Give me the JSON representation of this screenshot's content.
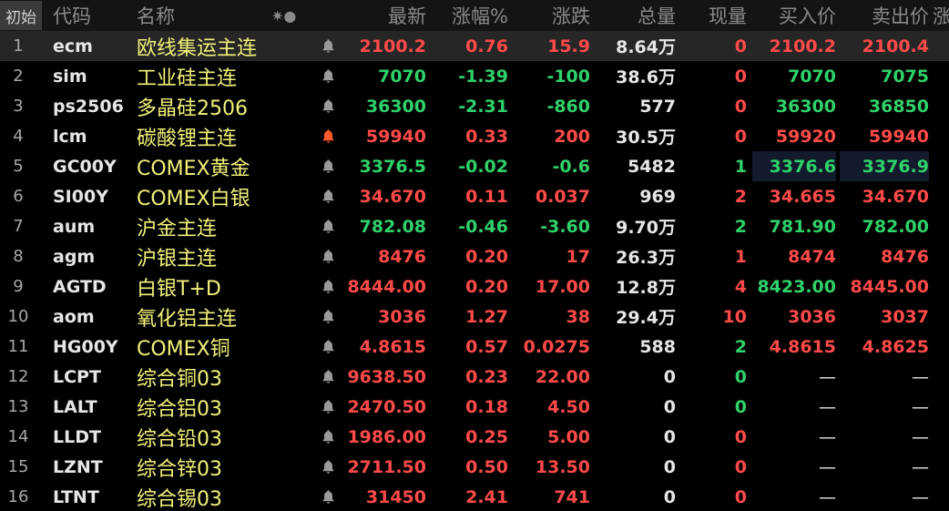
{
  "header": {
    "tag": "初始",
    "code": "代码",
    "name": "名称",
    "settings": "✷●",
    "last": "最新",
    "pct": "涨幅%",
    "change": "涨跌",
    "volume": "总量",
    "current": "现量",
    "bid": "买入价",
    "ask": "卖出价",
    "edge": "涨"
  },
  "rows": [
    {
      "idx": "1",
      "code": "ecm",
      "name": "欧线集运主连",
      "alert": false,
      "last": "2100.2",
      "pct": "0.76",
      "chg": "15.9",
      "vol": "8.64万",
      "cur": "0",
      "bid": "2100.2",
      "ask": "2100.4",
      "dir": "up",
      "cur_dir": "up",
      "bid_dir": "up",
      "ask_dir": "up"
    },
    {
      "idx": "2",
      "code": "sim",
      "name": "工业硅主连",
      "alert": false,
      "last": "7070",
      "pct": "-1.39",
      "chg": "-100",
      "vol": "38.6万",
      "cur": "0",
      "bid": "7070",
      "ask": "7075",
      "dir": "down",
      "cur_dir": "up",
      "bid_dir": "down",
      "ask_dir": "down"
    },
    {
      "idx": "3",
      "code": "ps2506",
      "name": "多晶硅2506",
      "alert": false,
      "last": "36300",
      "pct": "-2.31",
      "chg": "-860",
      "vol": "577",
      "cur": "0",
      "bid": "36300",
      "ask": "36850",
      "dir": "down",
      "cur_dir": "up",
      "bid_dir": "down",
      "ask_dir": "down"
    },
    {
      "idx": "4",
      "code": "lcm",
      "name": "碳酸锂主连",
      "alert": true,
      "last": "59940",
      "pct": "0.33",
      "chg": "200",
      "vol": "30.5万",
      "cur": "0",
      "bid": "59920",
      "ask": "59940",
      "dir": "up",
      "cur_dir": "up",
      "bid_dir": "up",
      "ask_dir": "up"
    },
    {
      "idx": "5",
      "code": "GC00Y",
      "name": "COMEX黄金",
      "alert": false,
      "last": "3376.5",
      "pct": "-0.02",
      "chg": "-0.6",
      "vol": "5482",
      "cur": "1",
      "bid": "3376.6",
      "ask": "3376.9",
      "dir": "down",
      "cur_dir": "down",
      "bid_dir": "down",
      "ask_dir": "down"
    },
    {
      "idx": "6",
      "code": "SI00Y",
      "name": "COMEX白银",
      "alert": false,
      "last": "34.670",
      "pct": "0.11",
      "chg": "0.037",
      "vol": "969",
      "cur": "2",
      "bid": "34.665",
      "ask": "34.670",
      "dir": "up",
      "cur_dir": "up",
      "bid_dir": "up",
      "ask_dir": "up"
    },
    {
      "idx": "7",
      "code": "aum",
      "name": "沪金主连",
      "alert": false,
      "last": "782.08",
      "pct": "-0.46",
      "chg": "-3.60",
      "vol": "9.70万",
      "cur": "2",
      "bid": "781.90",
      "ask": "782.00",
      "dir": "down",
      "cur_dir": "down",
      "bid_dir": "down",
      "ask_dir": "down"
    },
    {
      "idx": "8",
      "code": "agm",
      "name": "沪银主连",
      "alert": false,
      "last": "8476",
      "pct": "0.20",
      "chg": "17",
      "vol": "26.3万",
      "cur": "1",
      "bid": "8474",
      "ask": "8476",
      "dir": "up",
      "cur_dir": "up",
      "bid_dir": "up",
      "ask_dir": "up"
    },
    {
      "idx": "9",
      "code": "AGTD",
      "name": "白银T+D",
      "alert": false,
      "last": "8444.00",
      "pct": "0.20",
      "chg": "17.00",
      "vol": "12.8万",
      "cur": "4",
      "bid": "8423.00",
      "ask": "8445.00",
      "dir": "up",
      "cur_dir": "up",
      "bid_dir": "down",
      "ask_dir": "up"
    },
    {
      "idx": "10",
      "code": "aom",
      "name": "氧化铝主连",
      "alert": false,
      "last": "3036",
      "pct": "1.27",
      "chg": "38",
      "vol": "29.4万",
      "cur": "10",
      "bid": "3036",
      "ask": "3037",
      "dir": "up",
      "cur_dir": "up",
      "bid_dir": "up",
      "ask_dir": "up"
    },
    {
      "idx": "11",
      "code": "HG00Y",
      "name": "COMEX铜",
      "alert": false,
      "last": "4.8615",
      "pct": "0.57",
      "chg": "0.0275",
      "vol": "588",
      "cur": "2",
      "bid": "4.8615",
      "ask": "4.8625",
      "dir": "up",
      "cur_dir": "down",
      "bid_dir": "up",
      "ask_dir": "up"
    },
    {
      "idx": "12",
      "code": "LCPT",
      "name": "综合铜03",
      "alert": false,
      "last": "9638.50",
      "pct": "0.23",
      "chg": "22.00",
      "vol": "0",
      "cur": "0",
      "bid": "—",
      "ask": "—",
      "dir": "up",
      "cur_dir": "down",
      "bid_dir": "flat",
      "ask_dir": "flat"
    },
    {
      "idx": "13",
      "code": "LALT",
      "name": "综合铝03",
      "alert": false,
      "last": "2470.50",
      "pct": "0.18",
      "chg": "4.50",
      "vol": "0",
      "cur": "0",
      "bid": "—",
      "ask": "—",
      "dir": "up",
      "cur_dir": "down",
      "bid_dir": "flat",
      "ask_dir": "flat"
    },
    {
      "idx": "14",
      "code": "LLDT",
      "name": "综合铅03",
      "alert": false,
      "last": "1986.00",
      "pct": "0.25",
      "chg": "5.00",
      "vol": "0",
      "cur": "0",
      "bid": "—",
      "ask": "—",
      "dir": "up",
      "cur_dir": "up",
      "bid_dir": "flat",
      "ask_dir": "flat"
    },
    {
      "idx": "15",
      "code": "LZNT",
      "name": "综合锌03",
      "alert": false,
      "last": "2711.50",
      "pct": "0.50",
      "chg": "13.50",
      "vol": "0",
      "cur": "0",
      "bid": "—",
      "ask": "—",
      "dir": "up",
      "cur_dir": "up",
      "bid_dir": "flat",
      "ask_dir": "flat"
    },
    {
      "idx": "16",
      "code": "LTNT",
      "name": "综合锡03",
      "alert": false,
      "last": "31450",
      "pct": "2.41",
      "chg": "741",
      "vol": "0",
      "cur": "0",
      "bid": "—",
      "ask": "—",
      "dir": "up",
      "cur_dir": "up",
      "bid_dir": "flat",
      "ask_dir": "flat"
    }
  ],
  "colors": {
    "up": "#ff4a4a",
    "down": "#2fd16a",
    "name": "#f2f27a",
    "bell": "#9a9a9a",
    "bell_alert": "#ff5a2a",
    "selected_row": "#262626",
    "header_bg": "#141414"
  },
  "icons": {
    "alert_icon": "bell-icon",
    "settings_icon": "settings-icon"
  },
  "state": {
    "selected_row_index": 0,
    "highlighted_row_index": 4,
    "highlighted_columns": [
      "bid",
      "ask"
    ]
  }
}
